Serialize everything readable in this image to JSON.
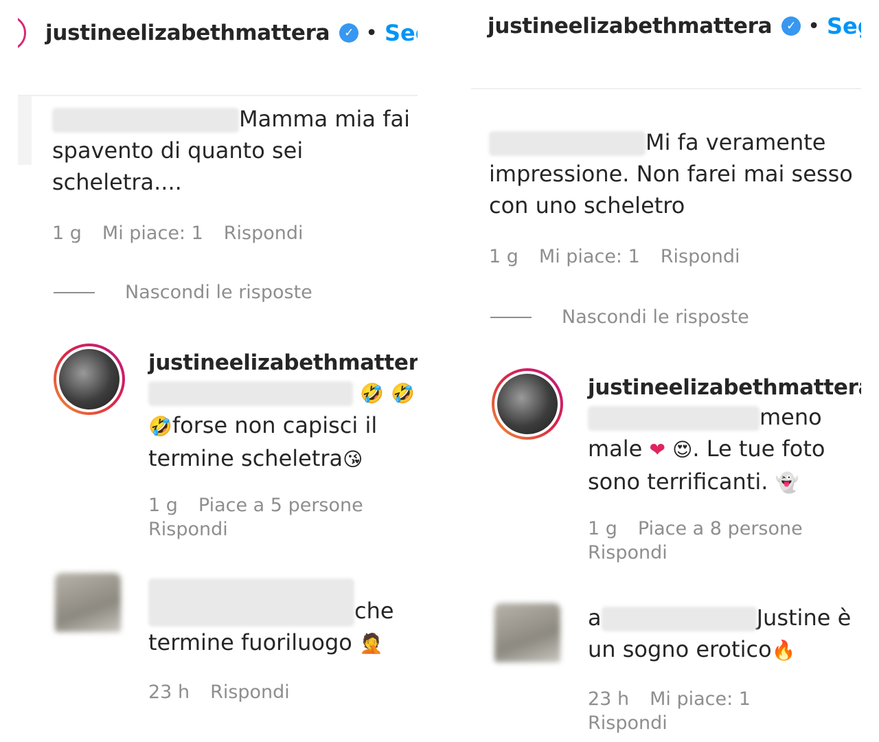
{
  "left": {
    "header": {
      "username": "justineelizabethmattera",
      "verified_glyph": "✓",
      "separator": "•",
      "follow_label": "Segui"
    },
    "comment": {
      "text_line1": "Mamma mia fai",
      "text_line2": "spavento di quanto sei",
      "text_line3": "scheletra....",
      "time": "1 g",
      "likes": "Mi piace: 1",
      "reply": "Rispondi"
    },
    "hide_replies": "Nascondi le risposte",
    "reply1": {
      "username": "justineelizabethmattera",
      "emoji1": "🤣",
      "emoji2": "🤣",
      "emoji3": "🤣",
      "text_line2": "forse non capisci il",
      "text_line3": "termine scheletra",
      "emoji4": "😘",
      "time": "1 g",
      "likes": "Piace a 5 persone",
      "reply": "Rispondi"
    },
    "reply2": {
      "text_line1": "che",
      "text_line2": "termine fuoriluogo",
      "emoji": "🤦",
      "time": "23 h",
      "reply": "Rispondi"
    }
  },
  "right": {
    "header": {
      "username": "justineelizabethmattera",
      "verified_glyph": "✓",
      "separator": "•",
      "follow_label": "Segui"
    },
    "comment": {
      "text_line1": "Mi fa veramente",
      "text_line2": "impressione. Non farei mai sesso",
      "text_line3": "con uno scheletro",
      "time": "1 g",
      "likes": "Mi piace: 1",
      "reply": "Rispondi"
    },
    "hide_replies": "Nascondi le risposte",
    "reply1": {
      "username": "justineelizabethmattera",
      "text_line1": "meno",
      "text_line2a": "male",
      "heart": "❤",
      "emoji_eyes": "😍",
      "text_line2b": ". Le tue foto",
      "text_line3": "sono terrificanti.",
      "emoji_ghost": "👻",
      "time": "1 g",
      "likes": "Piace a 8 persone",
      "reply": "Rispondi"
    },
    "reply2": {
      "prefix": "a",
      "text_line1": "Justine è",
      "text_line2": "un sogno erotico",
      "emoji": "🔥",
      "time": "23 h",
      "likes": "Mi piace: 1",
      "reply": "Rispondi"
    }
  }
}
